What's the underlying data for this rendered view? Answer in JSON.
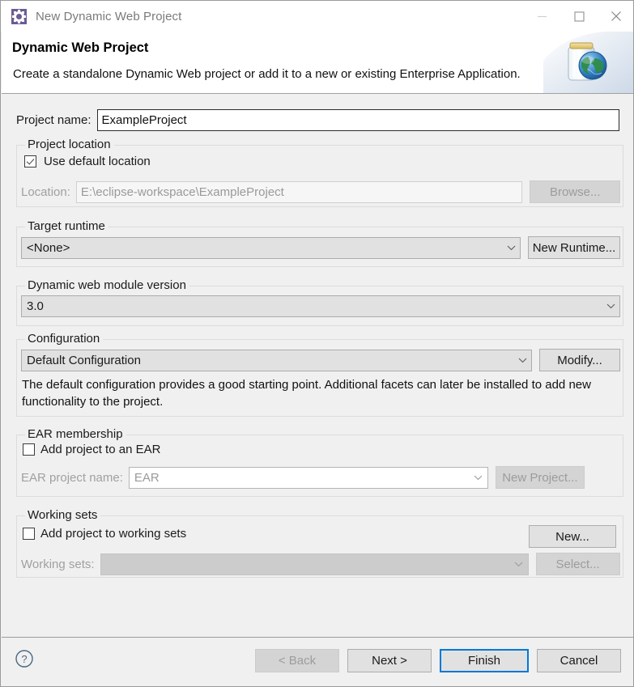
{
  "window": {
    "title": "New Dynamic Web Project",
    "icon": "eclipse-gear-icon",
    "minimize_label": "—",
    "maximize_label": "□",
    "close_label": "×"
  },
  "header": {
    "title": "Dynamic Web Project",
    "description": "Create a standalone Dynamic Web project or add it to a new or existing Enterprise Application.",
    "banner_icon": "web-jar-globe-icon"
  },
  "project_name": {
    "label": "Project name:",
    "value": "ExampleProject"
  },
  "project_location": {
    "group_label": "Project location",
    "use_default_label": "Use default location",
    "use_default_checked": true,
    "location_label": "Location:",
    "location_value": "E:\\eclipse-workspace\\ExampleProject",
    "browse_label": "Browse...",
    "browse_enabled": false
  },
  "target_runtime": {
    "group_label": "Target runtime",
    "value": "<None>",
    "new_runtime_label": "New Runtime..."
  },
  "module_version": {
    "group_label": "Dynamic web module version",
    "value": "3.0"
  },
  "configuration": {
    "group_label": "Configuration",
    "value": "Default Configuration",
    "modify_label": "Modify...",
    "description": "The default configuration provides a good starting point. Additional facets can later be installed to add new functionality to the project."
  },
  "ear_membership": {
    "group_label": "EAR membership",
    "add_to_ear_label": "Add project to an EAR",
    "add_to_ear_checked": false,
    "ear_project_name_label": "EAR project name:",
    "ear_project_name_value": "EAR",
    "new_project_label": "New Project...",
    "new_project_enabled": false
  },
  "working_sets": {
    "group_label": "Working sets",
    "add_to_working_sets_label": "Add project to working sets",
    "add_to_working_sets_checked": false,
    "new_label": "New...",
    "working_sets_label": "Working sets:",
    "working_sets_value": "",
    "select_label": "Select...",
    "select_enabled": false
  },
  "footer": {
    "help_icon": "help-question-icon",
    "back_label": "< Back",
    "back_enabled": false,
    "next_label": "Next >",
    "finish_label": "Finish",
    "cancel_label": "Cancel"
  },
  "colors": {
    "accent": "#0078d7",
    "dialog_bg": "#f0f0f0",
    "header_bg": "#ffffff",
    "title_text": "#7a7a7a",
    "disabled_text": "#9a9a9a"
  }
}
